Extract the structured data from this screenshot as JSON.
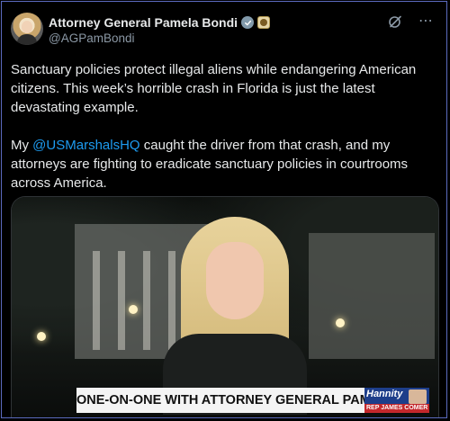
{
  "author": {
    "display_name": "Attorney General Pamela Bondi",
    "handle": "@AGPamBondi"
  },
  "icons": [
    "verified-badge-icon",
    "official-seal-icon",
    "grok-icon",
    "more-icon"
  ],
  "tweet": {
    "paragraph1": "Sanctuary policies protect illegal aliens while endangering American citizens. This week’s horrible crash in Florida is just the latest devastating example.",
    "p2_before": "My ",
    "mention": "@USMarshalsHQ",
    "p2_after": " caught the driver from that crash, and my attorneys are fighting to eradicate sanctuary policies in courtrooms across America."
  },
  "media": {
    "lower_third_title": "ONE-ON-ONE WITH ATTORNEY GENERAL PAM BONDI",
    "show_name": "Hannity",
    "guest_label": "REP JAMES COMER"
  },
  "colors": {
    "background": "#000000",
    "text": "#e7e9ea",
    "secondary": "#8b98a5",
    "link": "#1d9bf0"
  }
}
